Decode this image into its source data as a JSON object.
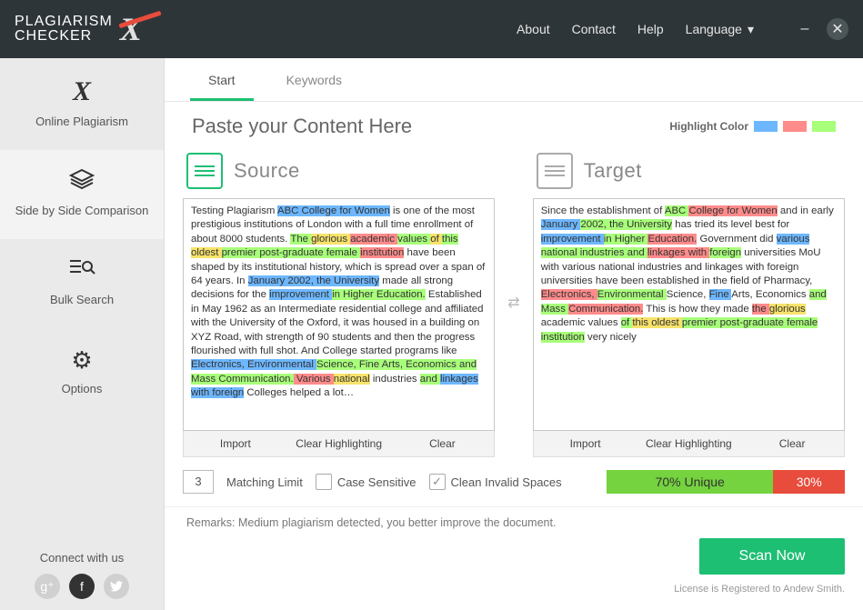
{
  "app": {
    "logo_top": "PLAGIARISM",
    "logo_bottom": "CHECKER"
  },
  "nav": {
    "about": "About",
    "contact": "Contact",
    "help": "Help",
    "language": "Language"
  },
  "sidebar": {
    "items": [
      {
        "label": "Online Plagiarism"
      },
      {
        "label": "Side by Side Comparison"
      },
      {
        "label": "Bulk Search"
      },
      {
        "label": "Options"
      }
    ],
    "connect": "Connect with us"
  },
  "tabs": {
    "start": "Start",
    "keywords": "Keywords"
  },
  "page": {
    "title": "Paste your Content Here",
    "highlight_label": "Highlight Color"
  },
  "panels": {
    "source": {
      "title": "Source"
    },
    "target": {
      "title": "Target"
    },
    "actions": {
      "import": "Import",
      "clear_hl": "Clear Highlighting",
      "clear": "Clear"
    }
  },
  "options": {
    "matching_limit_value": "3",
    "matching_limit_label": "Matching Limit",
    "case_sensitive": "Case Sensitive",
    "clean_spaces": "Clean Invalid Spaces"
  },
  "result": {
    "unique_pct": "70% Unique",
    "dup_pct": "30%"
  },
  "remarks": "Remarks: Medium plagiarism detected, you better improve the document.",
  "scan": "Scan Now",
  "license": "License is Registered to Andew Smith.",
  "colors": {
    "blue": "#6db7ff",
    "red": "#ff8b8b",
    "green": "#a8ff7a"
  },
  "source_text": {
    "p1a": "Testing Plagiarism ",
    "p1b": "ABC College for Women",
    "p1c": " is one of the most prestigious institutions of London with a full time enrollment of about 8000 students. ",
    "p2a": "The ",
    "p2b": "glorious ",
    "p2c": "academic ",
    "p2d": "values ",
    "p2e": "of ",
    "p2f": "this ",
    "p2g": "oldest ",
    "p2h": "premier post-graduate female ",
    "p2i": "institution",
    "p3": " have been shaped by its institutional history, which is spread over a span of 64 years. In ",
    "p3b": "January 2002, the University",
    "p3c": " made all strong decisions for the ",
    "p3d": "improvement ",
    "p3e": "in Higher Education.",
    "p3f": " Established in May 1962 as an Intermediate residential college and affiliated with the University of the Oxford, it was housed in a building on XYZ Road, with strength of 90 students and then the progress flourished with full shot. And College started programs like ",
    "p4a": "Electronics, Environmental ",
    "p4b": "Science, ",
    "p4c": "Fine Arts, Economics and Mass Communication.",
    "p4d": " Various ",
    "p4e": "national",
    "p4f": " industries ",
    "p4g": "and ",
    "p4h": "linkages with foreign",
    "p4i": " Colleges helped a lot…"
  },
  "target_text": {
    "t1a": "Since the establishment of ",
    "t1b": "ABC ",
    "t1c": "College for Women",
    "t1d": " and in early ",
    "t1e": "January ",
    "t1f": "2002, the University",
    "t1g": " has tried its level best for ",
    "t1h": "improvement ",
    "t1i": "in Higher ",
    "t1j": "Education.",
    "t1k": " Government did ",
    "t1l": "various ",
    "t1m": "national industries and ",
    "t1n": "linkages with ",
    "t1o": "foreign",
    "t1p": " universities MoU with various national industries and linkages with foreign universities have been established in the field of Pharmacy, ",
    "t2a": "Electronics, ",
    "t2b": "Environmental ",
    "t2c": "Science, ",
    "t2d": "Fine ",
    "t2e": "Arts, Economics ",
    "t2f": "and Mass ",
    "t2g": "Communication.",
    "t2h": " This is how they made ",
    "t2i": "the ",
    "t2j": "glorious ",
    "t2k": "academic values ",
    "t2l": "of ",
    "t2m": "this oldest ",
    "t2n": "premier post-graduate female institution",
    "t2o": " very nicely"
  }
}
